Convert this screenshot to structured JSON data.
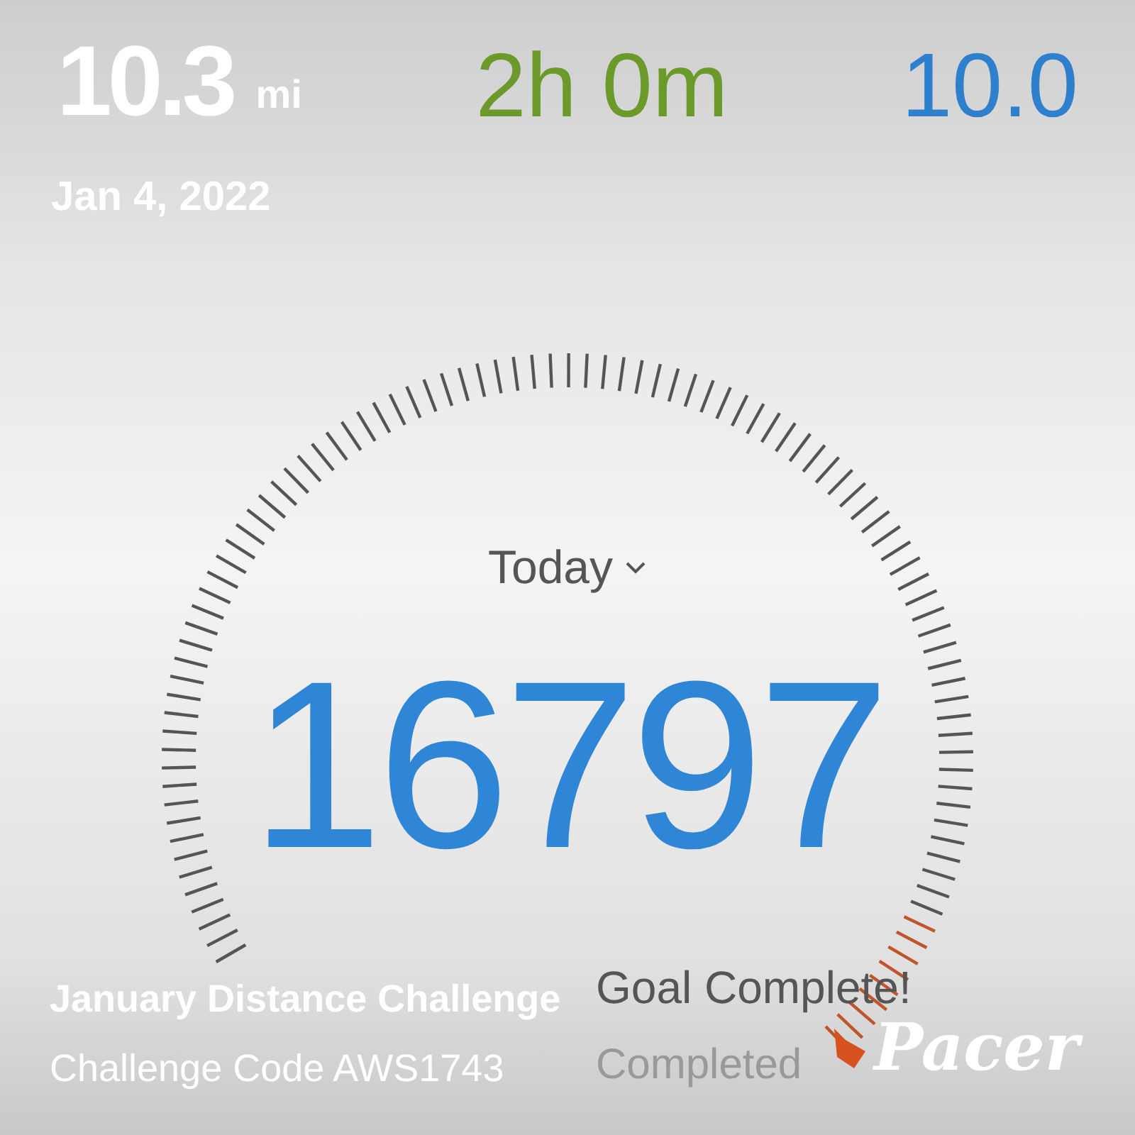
{
  "stats": [
    {
      "kind": "distance",
      "value": "10.3",
      "unit": "mi"
    },
    {
      "kind": "duration",
      "value": "2h 0m"
    },
    {
      "kind": "pace",
      "value": "10.0"
    }
  ],
  "date": "Jan 4, 2022",
  "gauge": {
    "period": "Today",
    "steps": "16797",
    "status": "Goal Complete!",
    "progress": "Completed"
  },
  "challenge": {
    "title": "January Distance Challenge",
    "code": "Challenge Code AWS1743"
  },
  "brand": "Pacer"
}
